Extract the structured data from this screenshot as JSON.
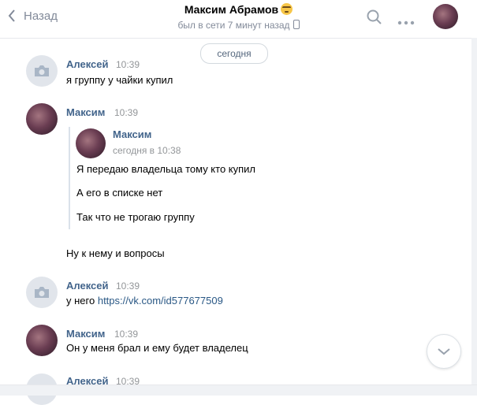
{
  "header": {
    "back_label": "Назад",
    "title": "Максим Абрамов",
    "subtitle": "был в сети 7 минут назад",
    "icons": [
      "chevron-left-icon",
      "search-icon",
      "more-icon",
      "emoji-sunglasses-icon",
      "phone-icon"
    ]
  },
  "date_divider": "сегодня",
  "messages": [
    {
      "author": "Алексей",
      "time": "10:39",
      "lines": [
        "я группу у чайки купил"
      ]
    },
    {
      "author": "Максим",
      "time": "10:39",
      "forwarded": {
        "author": "Максим",
        "time": "сегодня в 10:38",
        "lines": [
          "Я передаю владельца тому кто купил",
          "А его в списке нет",
          "Так что не трогаю группу"
        ]
      },
      "lines": [
        "Ну к нему и вопросы"
      ]
    },
    {
      "author": "Алексей",
      "time": "10:39",
      "text_prefix": "у него",
      "link": "https://vk.com/id577677509"
    },
    {
      "author": "Максим",
      "time": "10:39",
      "lines": [
        "Он у меня брал и ему будет владелец"
      ]
    },
    {
      "author": "Алексей",
      "time": "10:39"
    }
  ],
  "colors": {
    "name": "#42648b",
    "link": "#2a5885",
    "meta": "#939699",
    "muted": "#828a99"
  }
}
